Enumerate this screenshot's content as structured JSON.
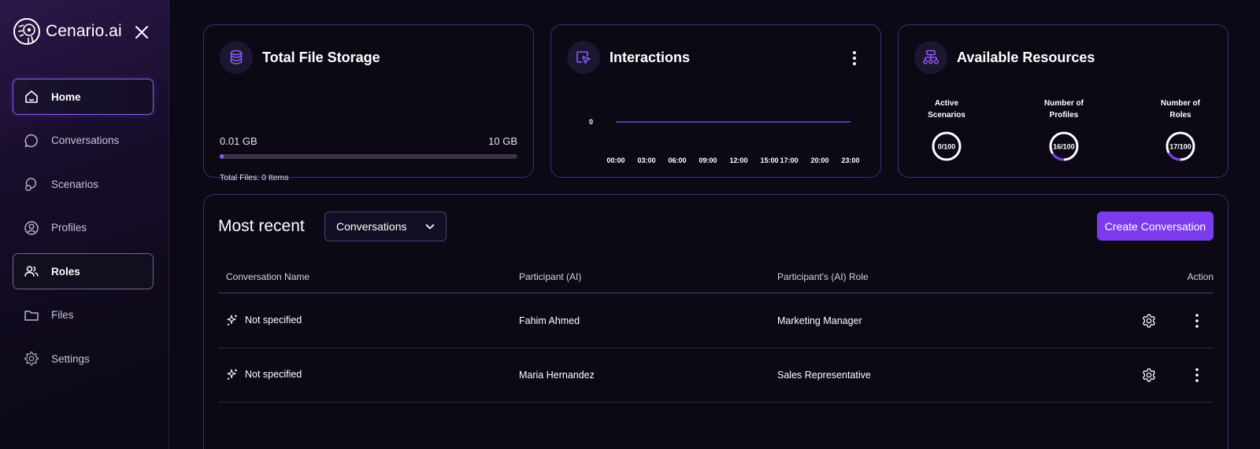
{
  "app": {
    "brand": "Cenario.ai"
  },
  "sidebar": {
    "items": [
      {
        "label": "Home",
        "icon": "home-icon"
      },
      {
        "label": "Conversations",
        "icon": "chat-bubble-icon"
      },
      {
        "label": "Scenarios",
        "icon": "scenario-bubbles-icon"
      },
      {
        "label": "Profiles",
        "icon": "user-circle-icon"
      },
      {
        "label": "Roles",
        "icon": "users-icon"
      },
      {
        "label": "Files",
        "icon": "folder-icon"
      },
      {
        "label": "Settings",
        "icon": "gear-icon"
      }
    ]
  },
  "storage": {
    "title": "Total File Storage",
    "used": "0.01 GB",
    "total": "10 GB",
    "used_fraction": 0.01,
    "files": "Total Files: 0 Items"
  },
  "interactions": {
    "title": "Interactions",
    "chart_data": {
      "type": "line",
      "x": [
        "00:00",
        "03:00",
        "06:00",
        "09:00",
        "12:00",
        "15:00",
        "17:00",
        "20:00",
        "23:00"
      ],
      "series": [
        {
          "values": [
            0,
            0,
            0,
            0,
            0,
            0,
            0,
            0,
            0
          ]
        }
      ],
      "y_tick_labels": [
        "0"
      ],
      "ylim": [
        0,
        0
      ],
      "grid": false,
      "color": "#7c5cff"
    }
  },
  "resources": {
    "title": "Available Resources",
    "items": [
      {
        "label_line1": "Active",
        "label_line2": "Scenarios",
        "value": "0/100",
        "fraction": 0.0
      },
      {
        "label_line1": "Number of",
        "label_line2": "Profiles",
        "value": "16/100",
        "fraction": 0.16
      },
      {
        "label_line1": "Number of",
        "label_line2": "Roles",
        "value": "17/100",
        "fraction": 0.17
      }
    ]
  },
  "recent": {
    "title": "Most recent",
    "dropdown_value": "Conversations",
    "create_label": "Create Conversation",
    "columns": [
      "Conversation Name",
      "Participant (AI)",
      "Participant's (AI) Role",
      "Action"
    ],
    "rows": [
      {
        "name": "Not specified",
        "participant": "Fahim Ahmed",
        "role": "Marketing Manager"
      },
      {
        "name": "Not specified",
        "participant": "Maria Hernandez",
        "role": "Sales Representative"
      }
    ]
  },
  "colors": {
    "accent": "#7c3aed",
    "card_border": "#3d3170",
    "background": "#0d0816"
  }
}
